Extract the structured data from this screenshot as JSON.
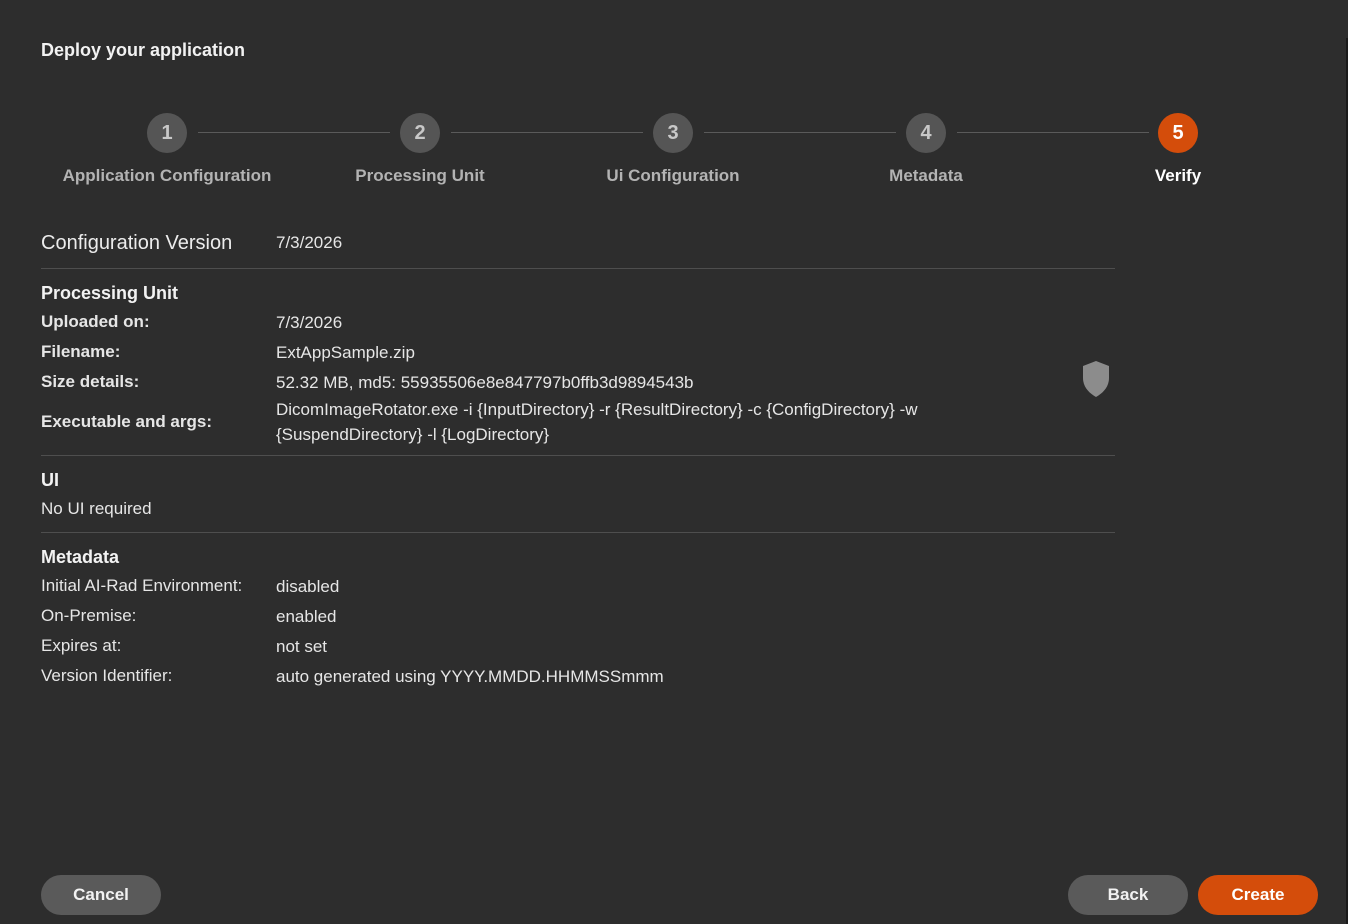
{
  "dialog": {
    "title": "Deploy your application"
  },
  "colors": {
    "accent": "#d44d0b",
    "step_inactive": "#555555",
    "background": "#2d2d2d"
  },
  "stepper": {
    "steps": [
      {
        "number": "1",
        "label": "Application Configuration",
        "active": false
      },
      {
        "number": "2",
        "label": "Processing Unit",
        "active": false
      },
      {
        "number": "3",
        "label": "Ui Configuration",
        "active": false
      },
      {
        "number": "4",
        "label": "Metadata",
        "active": false
      },
      {
        "number": "5",
        "label": "Verify",
        "active": true
      }
    ]
  },
  "configuration": {
    "label": "Configuration Version",
    "value": "7/3/2026"
  },
  "processing_unit": {
    "title": "Processing Unit",
    "uploaded_label": "Uploaded on:",
    "uploaded_value": "7/3/2026",
    "filename_label": "Filename:",
    "filename_value": "ExtAppSample.zip",
    "size_label": "Size details:",
    "size_value": "52.32 MB, md5: 55935506e8e847797b0ffb3d9894543b",
    "exec_label": "Executable and args:",
    "exec_value": "DicomImageRotator.exe -i {InputDirectory} -r {ResultDirectory} -c {ConfigDirectory} -w {SuspendDirectory} -l {LogDirectory}",
    "status_icon": "shield-icon"
  },
  "ui": {
    "title": "UI",
    "value": "No UI required"
  },
  "metadata": {
    "title": "Metadata",
    "rows": [
      {
        "label": "Initial AI-Rad Environment:",
        "value": "disabled"
      },
      {
        "label": "On-Premise:",
        "value": "enabled"
      },
      {
        "label": "Expires at:",
        "value": "not set"
      },
      {
        "label": "Version Identifier:",
        "value": "auto generated using YYYY.MMDD.HHMMSSmmm"
      }
    ]
  },
  "buttons": {
    "cancel": "Cancel",
    "back": "Back",
    "create": "Create"
  }
}
